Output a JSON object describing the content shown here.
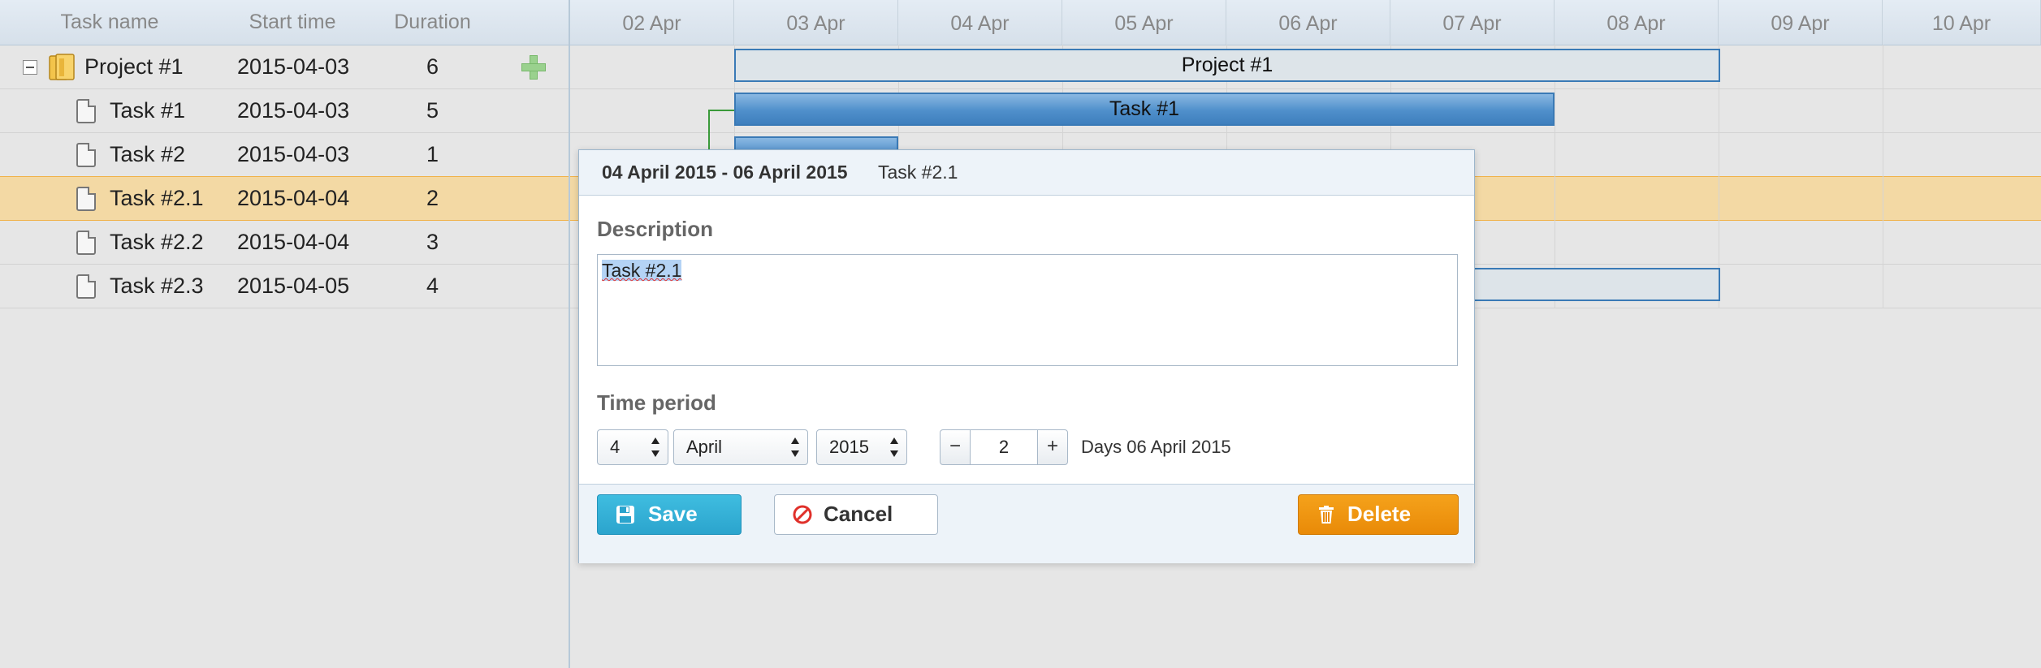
{
  "grid": {
    "columns": {
      "task_name": "Task name",
      "start_time": "Start time",
      "duration": "Duration"
    },
    "rows": [
      {
        "name": "Project #1",
        "start": "2015-04-03",
        "duration": "6"
      },
      {
        "name": "Task #1",
        "start": "2015-04-03",
        "duration": "5"
      },
      {
        "name": "Task #2",
        "start": "2015-04-03",
        "duration": "1"
      },
      {
        "name": "Task #2.1",
        "start": "2015-04-04",
        "duration": "2"
      },
      {
        "name": "Task #2.2",
        "start": "2015-04-04",
        "duration": "3"
      },
      {
        "name": "Task #2.3",
        "start": "2015-04-05",
        "duration": "4"
      }
    ]
  },
  "timeline": {
    "dates": [
      "02 Apr",
      "03 Apr",
      "04 Apr",
      "05 Apr",
      "06 Apr",
      "07 Apr",
      "08 Apr",
      "09 Apr",
      "10 Apr"
    ],
    "bars": {
      "project": "Project #1",
      "task1": "Task #1"
    }
  },
  "dialog": {
    "header_dates": "04 April 2015 - 06 April 2015",
    "header_task": "Task #2.1",
    "description_label": "Description",
    "description_text": "Task #2.1",
    "time_period_label": "Time period",
    "day": "4",
    "month": "April",
    "year": "2015",
    "duration_value": "2",
    "decrement": "−",
    "increment": "+",
    "days_end": "Days 06 April 2015",
    "save_label": "Save",
    "cancel_label": "Cancel",
    "delete_label": "Delete"
  },
  "colors": {
    "selected_row": "#f3d9a4",
    "bar_blue": "#4f8fcb",
    "save_button": "#2ba4cd",
    "delete_button": "#e98a08"
  }
}
